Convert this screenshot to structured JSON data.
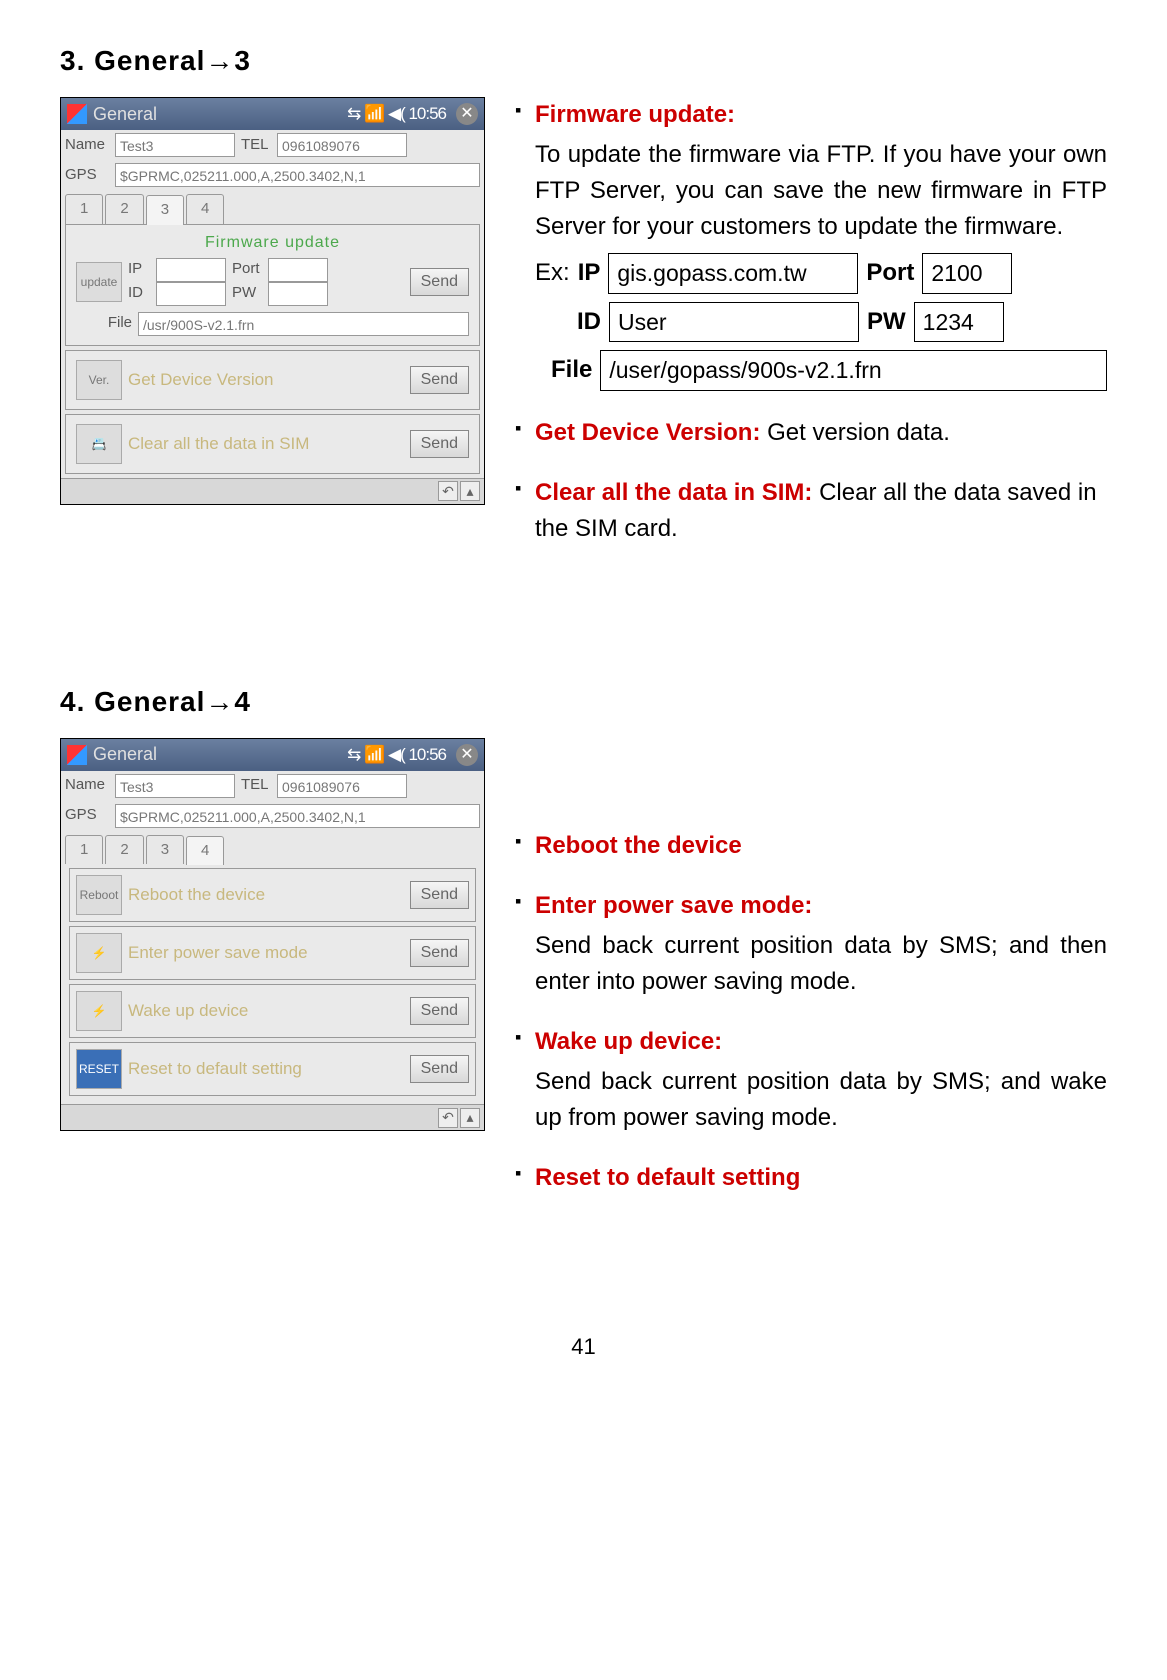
{
  "section1": {
    "heading": "3. General→3",
    "screenshot": {
      "titlebar": {
        "title": "General",
        "status": "⇆ 📶 ◀( 10:56"
      },
      "name_label": "Name",
      "name_value": "Test3",
      "tel_label": "TEL",
      "tel_value": "0961089076",
      "gps_label": "GPS",
      "gps_value": "$GPRMC,025211.000,A,2500.3402,N,1",
      "tabs": [
        "1",
        "2",
        "3",
        "4"
      ],
      "active_tab": "3",
      "panel_title": "Firmware update",
      "fw_ip_label": "IP",
      "fw_port_label": "Port",
      "fw_id_label": "ID",
      "fw_pw_label": "PW",
      "fw_file_label": "File",
      "fw_file_value": "/usr/900S-v2.1.frn",
      "fw_send": "Send",
      "ver_icon": "Ver.",
      "ver_label": "Get Device Version",
      "ver_send": "Send",
      "clear_label": "Clear all the data in SIM",
      "clear_send": "Send"
    },
    "bullets": [
      {
        "title": "Firmware update:",
        "desc": "To update the firmware via FTP. If you have your own FTP Server, you can save the new firmware in FTP Server for your customers to update the firmware.",
        "example": {
          "prefix": "Ex:",
          "ip_label": "IP",
          "ip_value": "gis.gopass.com.tw",
          "port_label": "Port",
          "port_value": "2100",
          "id_label": "ID",
          "id_value": "User",
          "pw_label": "PW",
          "pw_value": "1234",
          "file_label": "File",
          "file_value": "/user/gopass/900s-v2.1.frn"
        }
      },
      {
        "title": "Get Device Version:",
        "inline": "Get version data."
      },
      {
        "title": "Clear all the data in SIM:",
        "inline": "Clear all the data saved in the SIM card."
      }
    ]
  },
  "section2": {
    "heading": "4. General→4",
    "screenshot": {
      "titlebar": {
        "title": "General",
        "status": "⇆ 📶 ◀( 10:56"
      },
      "name_label": "Name",
      "name_value": "Test3",
      "tel_label": "TEL",
      "tel_value": "0961089076",
      "gps_label": "GPS",
      "gps_value": "$GPRMC,025211.000,A,2500.3402,N,1",
      "tabs": [
        "1",
        "2",
        "3",
        "4"
      ],
      "active_tab": "4",
      "rows": [
        {
          "icon": "Reboot",
          "label": "Reboot the device",
          "send": "Send"
        },
        {
          "icon": "⚡",
          "label": "Enter power save mode",
          "send": "Send"
        },
        {
          "icon": "⚡",
          "label": "Wake up device",
          "send": "Send"
        },
        {
          "icon": "RESET",
          "label": "Reset to default setting",
          "send": "Send"
        }
      ]
    },
    "bullets": [
      {
        "title": "Reboot the device"
      },
      {
        "title": "Enter power save mode:",
        "desc": "Send back current position data by SMS; and then enter into power saving mode."
      },
      {
        "title": "Wake up device:",
        "desc": "Send back current position data by SMS; and wake up from power saving mode."
      },
      {
        "title": "Reset to default setting"
      }
    ]
  },
  "page_number": "41"
}
